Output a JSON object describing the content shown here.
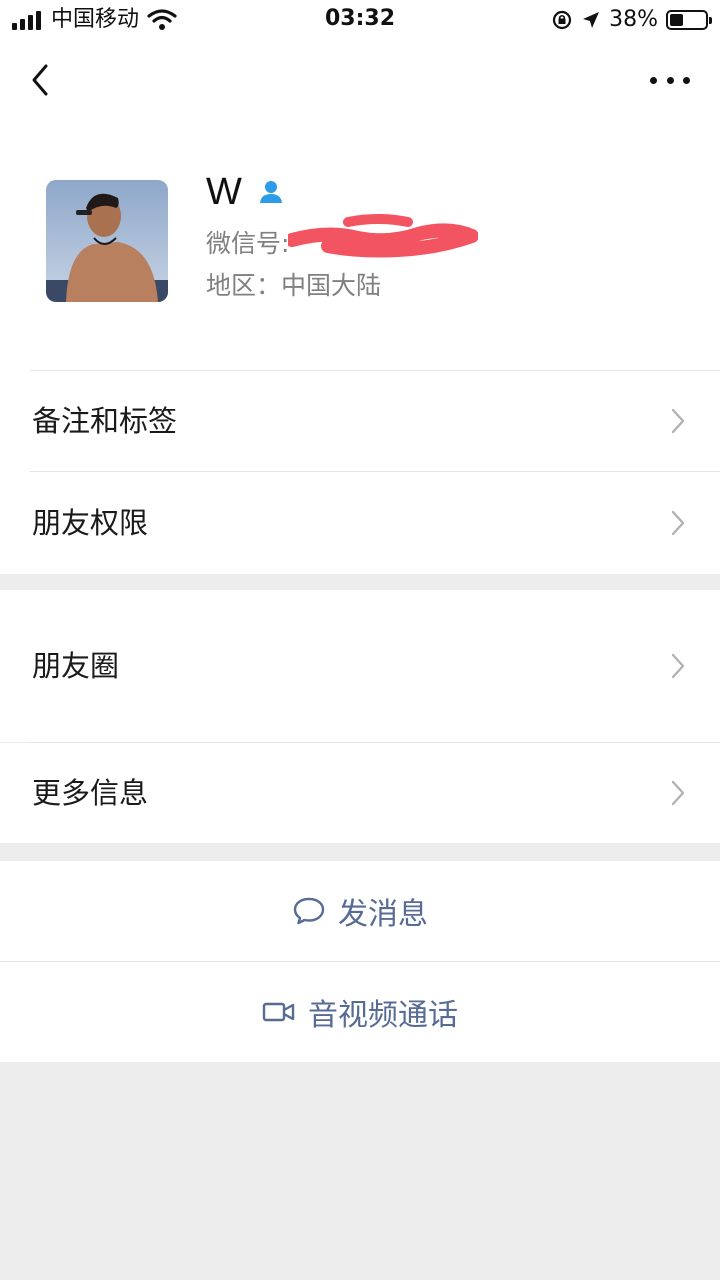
{
  "status_bar": {
    "carrier": "中国移动",
    "time": "03:32",
    "battery": "38%"
  },
  "profile": {
    "name": "W",
    "wechat_id_label": "微信号:",
    "region": "地区：中国大陆"
  },
  "menu": {
    "remarks_tags": "备注和标签",
    "friend_permissions": "朋友权限",
    "moments": "朋友圈",
    "more_info": "更多信息"
  },
  "actions": {
    "send_message": "发消息",
    "av_call": "音视频通话"
  },
  "colors": {
    "link": "#576b95",
    "contact_icon": "#2d9ce8",
    "redact": "#f25461"
  }
}
